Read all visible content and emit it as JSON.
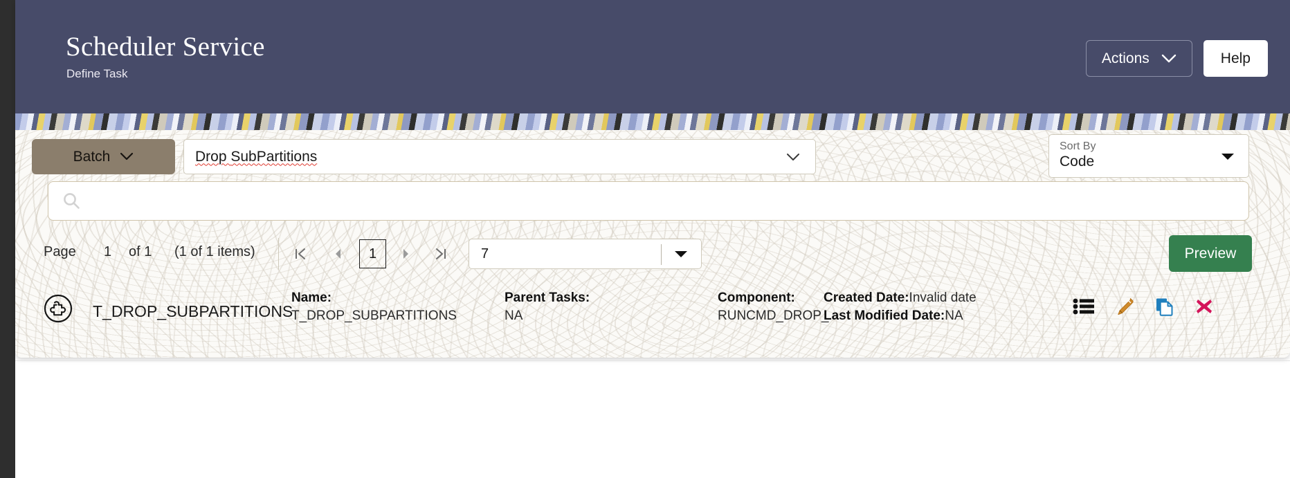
{
  "header": {
    "title": "Scheduler Service",
    "subtitle": "Define Task",
    "actions_label": "Actions",
    "help_label": "Help"
  },
  "toolbar": {
    "batch_label": "Batch",
    "task_type_value_prefix": "Drop ",
    "task_type_value_misspelled": "SubPartitions",
    "task_type_value": "Drop SubPartitions",
    "sort_by_label": "Sort By",
    "sort_by_value": "Code"
  },
  "search": {
    "value": "",
    "placeholder": ""
  },
  "pager": {
    "page_label": "Page",
    "page_current": "1",
    "page_of": "of 1",
    "items_count": "(1 of 1 items)",
    "page_input_value": "1",
    "rows_per_page": "7",
    "preview_label": "Preview"
  },
  "result_row": {
    "code": "T_DROP_SUBPARTITIONS",
    "name_label": "Name:",
    "name_value": "T_DROP_SUBPARTITIONS",
    "parent_tasks_label": "Parent Tasks:",
    "parent_tasks_value": "NA",
    "component_label": "Component:",
    "component_value": "RUNCMD_DROP_...",
    "created_date_label": "Created Date:",
    "created_date_value": "Invalid date",
    "last_modified_label": "Last Modified Date:",
    "last_modified_value": "NA"
  },
  "colors": {
    "header_bg": "#474b69",
    "batch_button": "#8b7e6c",
    "preview_button": "#35804f",
    "content_bg": "#fbfaf7",
    "edit_icon": "#d08b2c",
    "copy_icon": "#1f7fbd",
    "delete_icon": "#d4145a",
    "border": "#cfcabb"
  }
}
